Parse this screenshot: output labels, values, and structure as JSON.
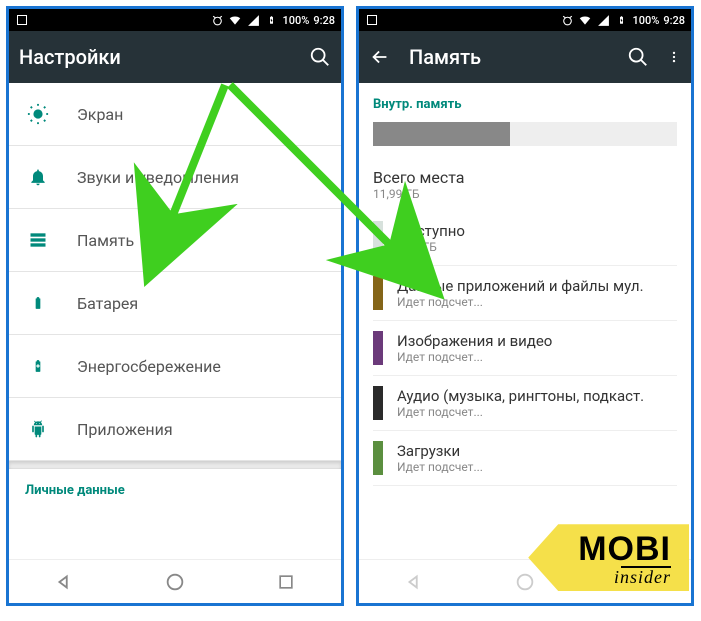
{
  "statusbar": {
    "battery_pct": "100%",
    "time": "9:28"
  },
  "phone1": {
    "title": "Настройки",
    "items": [
      {
        "label": "Экран"
      },
      {
        "label": "Звуки и уведомления"
      },
      {
        "label": "Память"
      },
      {
        "label": "Батарея"
      },
      {
        "label": "Энергосбережение"
      },
      {
        "label": "Приложения"
      }
    ],
    "section2_header": "Личные данные"
  },
  "phone2": {
    "title": "Память",
    "section_header": "Внутр. память",
    "total": {
      "title": "Всего места",
      "sub": "11,99 ГБ"
    },
    "available": {
      "title": "Доступно",
      "sub": "6,63 ГБ",
      "color": "#d7e1dc"
    },
    "categories": [
      {
        "title": "Данные приложений и файлы мул.",
        "sub": "Идет подсчет...",
        "color": "#846518"
      },
      {
        "title": "Изображения и видео",
        "sub": "Идет подсчет...",
        "color": "#6b3a7a"
      },
      {
        "title": "Аудио (музыка, рингтоны, подкаст.",
        "sub": "Идет подсчет...",
        "color": "#2a2a2a"
      },
      {
        "title": "Загрузки",
        "sub": "Идет подсчет...",
        "color": "#5b8f3f"
      }
    ]
  },
  "badge": {
    "big": "MOBI",
    "small": "insider"
  }
}
